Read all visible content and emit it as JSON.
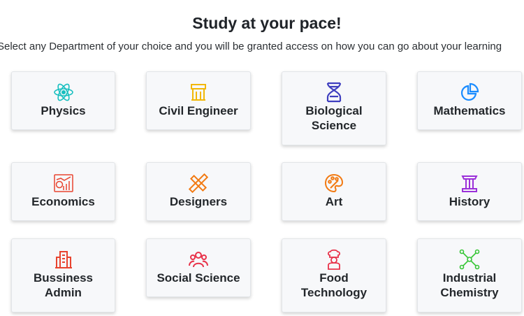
{
  "header": {
    "title": "Study at your pace!",
    "subtitle": "Select any Department of your choice and you will be granted access on how you can go about your learning"
  },
  "colors": {
    "physics": "#17bfbf",
    "civil": "#f2b705",
    "bio": "#3f3fbf",
    "math": "#1a8cff",
    "econ": "#e8442f",
    "design": "#f27a12",
    "art": "#f27a12",
    "history": "#9b30d9",
    "business": "#e8442f",
    "social": "#e8334a",
    "food": "#e8334a",
    "chem": "#37c637"
  },
  "departments": [
    {
      "label": "Physics",
      "icon": "atom-icon"
    },
    {
      "label": "Civil Engineer",
      "icon": "building-icon"
    },
    {
      "label": "Biological Science",
      "icon": "dna-icon"
    },
    {
      "label": "Mathematics",
      "icon": "pie-chart-icon"
    },
    {
      "label": "Economics",
      "icon": "finance-chart-icon"
    },
    {
      "label": "Designers",
      "icon": "pencil-ruler-icon"
    },
    {
      "label": "Art",
      "icon": "palette-icon"
    },
    {
      "label": "History",
      "icon": "pillar-icon"
    },
    {
      "label": "Bussiness Admin",
      "icon": "office-building-icon"
    },
    {
      "label": "Social Science",
      "icon": "people-group-icon"
    },
    {
      "label": "Food Technology",
      "icon": "chef-icon"
    },
    {
      "label": "Industrial Chemistry",
      "icon": "molecule-icon"
    }
  ]
}
